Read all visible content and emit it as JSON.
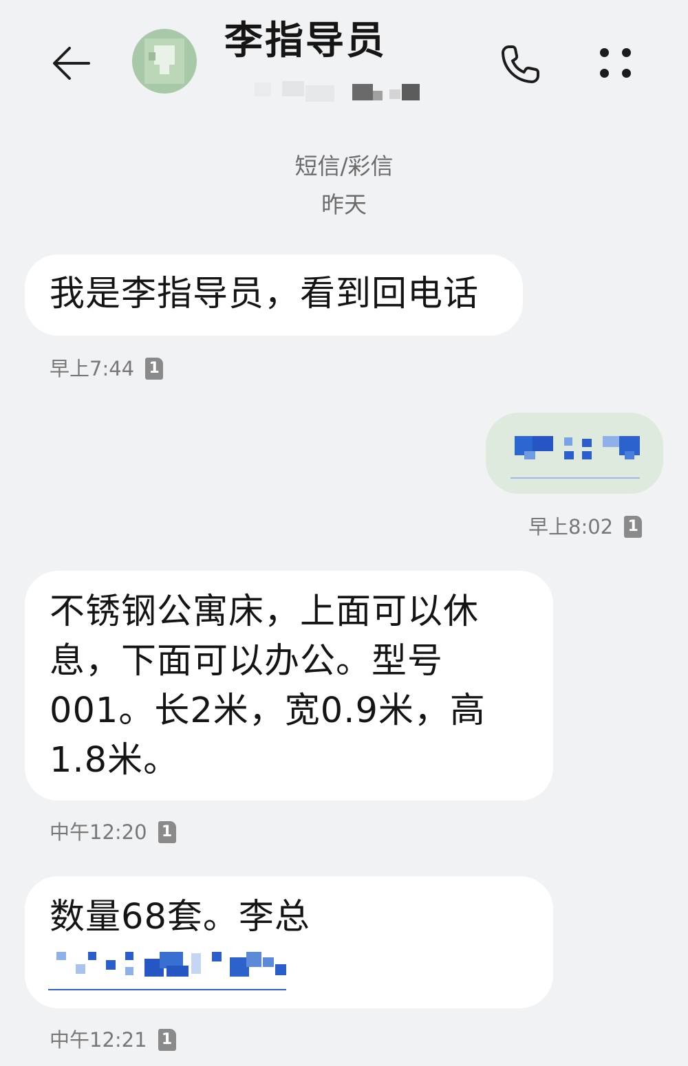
{
  "header": {
    "contact_name": "李指导员",
    "back_icon": "arrow-left-icon",
    "call_icon": "phone-icon",
    "more_icon": "more-dots-icon"
  },
  "conversation": {
    "type_label": "短信/彩信",
    "date_label": "昨天"
  },
  "messages": [
    {
      "direction": "incoming",
      "text": "我是李指导员，看到回电话",
      "time": "早上7:44",
      "sim": "1"
    },
    {
      "direction": "outgoing",
      "text": "",
      "time": "早上8:02",
      "sim": "1"
    },
    {
      "direction": "incoming",
      "text": "不锈钢公寓床，上面可以休\n息，下面可以办公。型号\n001。长2米，宽0.9米，高\n1.8米。",
      "time": "中午12:20",
      "sim": "1"
    },
    {
      "direction": "incoming",
      "text": "数量68套。李总",
      "time": "中午12:21",
      "sim": "1"
    }
  ],
  "colors": {
    "background": "#f1f2f4",
    "incoming_bubble": "#ffffff",
    "outgoing_bubble": "#dfeade",
    "link": "#2a63c7",
    "meta_text": "#777777"
  }
}
